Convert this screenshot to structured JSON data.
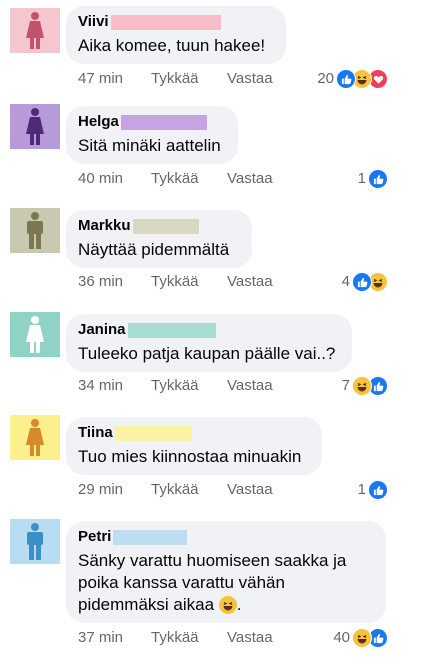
{
  "comments": [
    {
      "name": "Viivi",
      "text": "Aika komee, tuun hakee!",
      "time": "47 min",
      "like_label": "Tykkää",
      "reply_label": "Vastaa",
      "reaction_count": "20",
      "reactions": [
        "like-icon",
        "haha-icon",
        "love-icon"
      ],
      "avatar_bg": "#f6c6cf",
      "avatar_color": "#c0546a",
      "avatar_gender": "female",
      "name_bar_color": "#f8bcc6"
    },
    {
      "name": "Helga",
      "text": "Sitä minäki aattelin",
      "time": "40 min",
      "like_label": "Tykkää",
      "reply_label": "Vastaa",
      "reaction_count": "1",
      "reactions": [
        "like-icon"
      ],
      "avatar_bg": "#b79ad8",
      "avatar_color": "#4f2a78",
      "avatar_gender": "female",
      "name_bar_color": "#c6a4e4"
    },
    {
      "name": "Markku",
      "text": "Näyttää pidemmältä",
      "time": "36 min",
      "like_label": "Tykkää",
      "reply_label": "Vastaa",
      "reaction_count": "4",
      "reactions": [
        "like-icon",
        "haha-icon"
      ],
      "avatar_bg": "#c9c8b0",
      "avatar_color": "#7a7752",
      "avatar_gender": "male",
      "name_bar_color": "#d9d8c4"
    },
    {
      "name": "Janina",
      "text": "Tuleeko patja kaupan päälle vai..?",
      "time": "34 min",
      "like_label": "Tykkää",
      "reply_label": "Vastaa",
      "reaction_count": "7",
      "reactions": [
        "haha-icon",
        "like-icon"
      ],
      "avatar_bg": "#8fd3c6",
      "avatar_color": "#ffffff",
      "avatar_gender": "female",
      "name_bar_color": "#a6ddd2"
    },
    {
      "name": "Tiina",
      "text": "Tuo mies kiinnostaa minuakin",
      "time": "29 min",
      "like_label": "Tykkää",
      "reply_label": "Vastaa",
      "reaction_count": "1",
      "reactions": [
        "like-icon"
      ],
      "avatar_bg": "#fbf08c",
      "avatar_color": "#d7892c",
      "avatar_gender": "female",
      "name_bar_color": "#fbf3a3"
    },
    {
      "name": "Petri",
      "text": "Sänky varattu huomiseen saakka ja\npoika kanssa varattu vähän\npidemmäksi aikaa",
      "text_suffix": ".",
      "inline_emoji": "haha-icon",
      "time": "37 min",
      "like_label": "Tykkää",
      "reply_label": "Vastaa",
      "reaction_count": "40",
      "reactions": [
        "haha-icon",
        "like-icon"
      ],
      "avatar_bg": "#b8dcf2",
      "avatar_color": "#3d8fc7",
      "avatar_gender": "male",
      "name_bar_color": "#bddcf2"
    }
  ]
}
